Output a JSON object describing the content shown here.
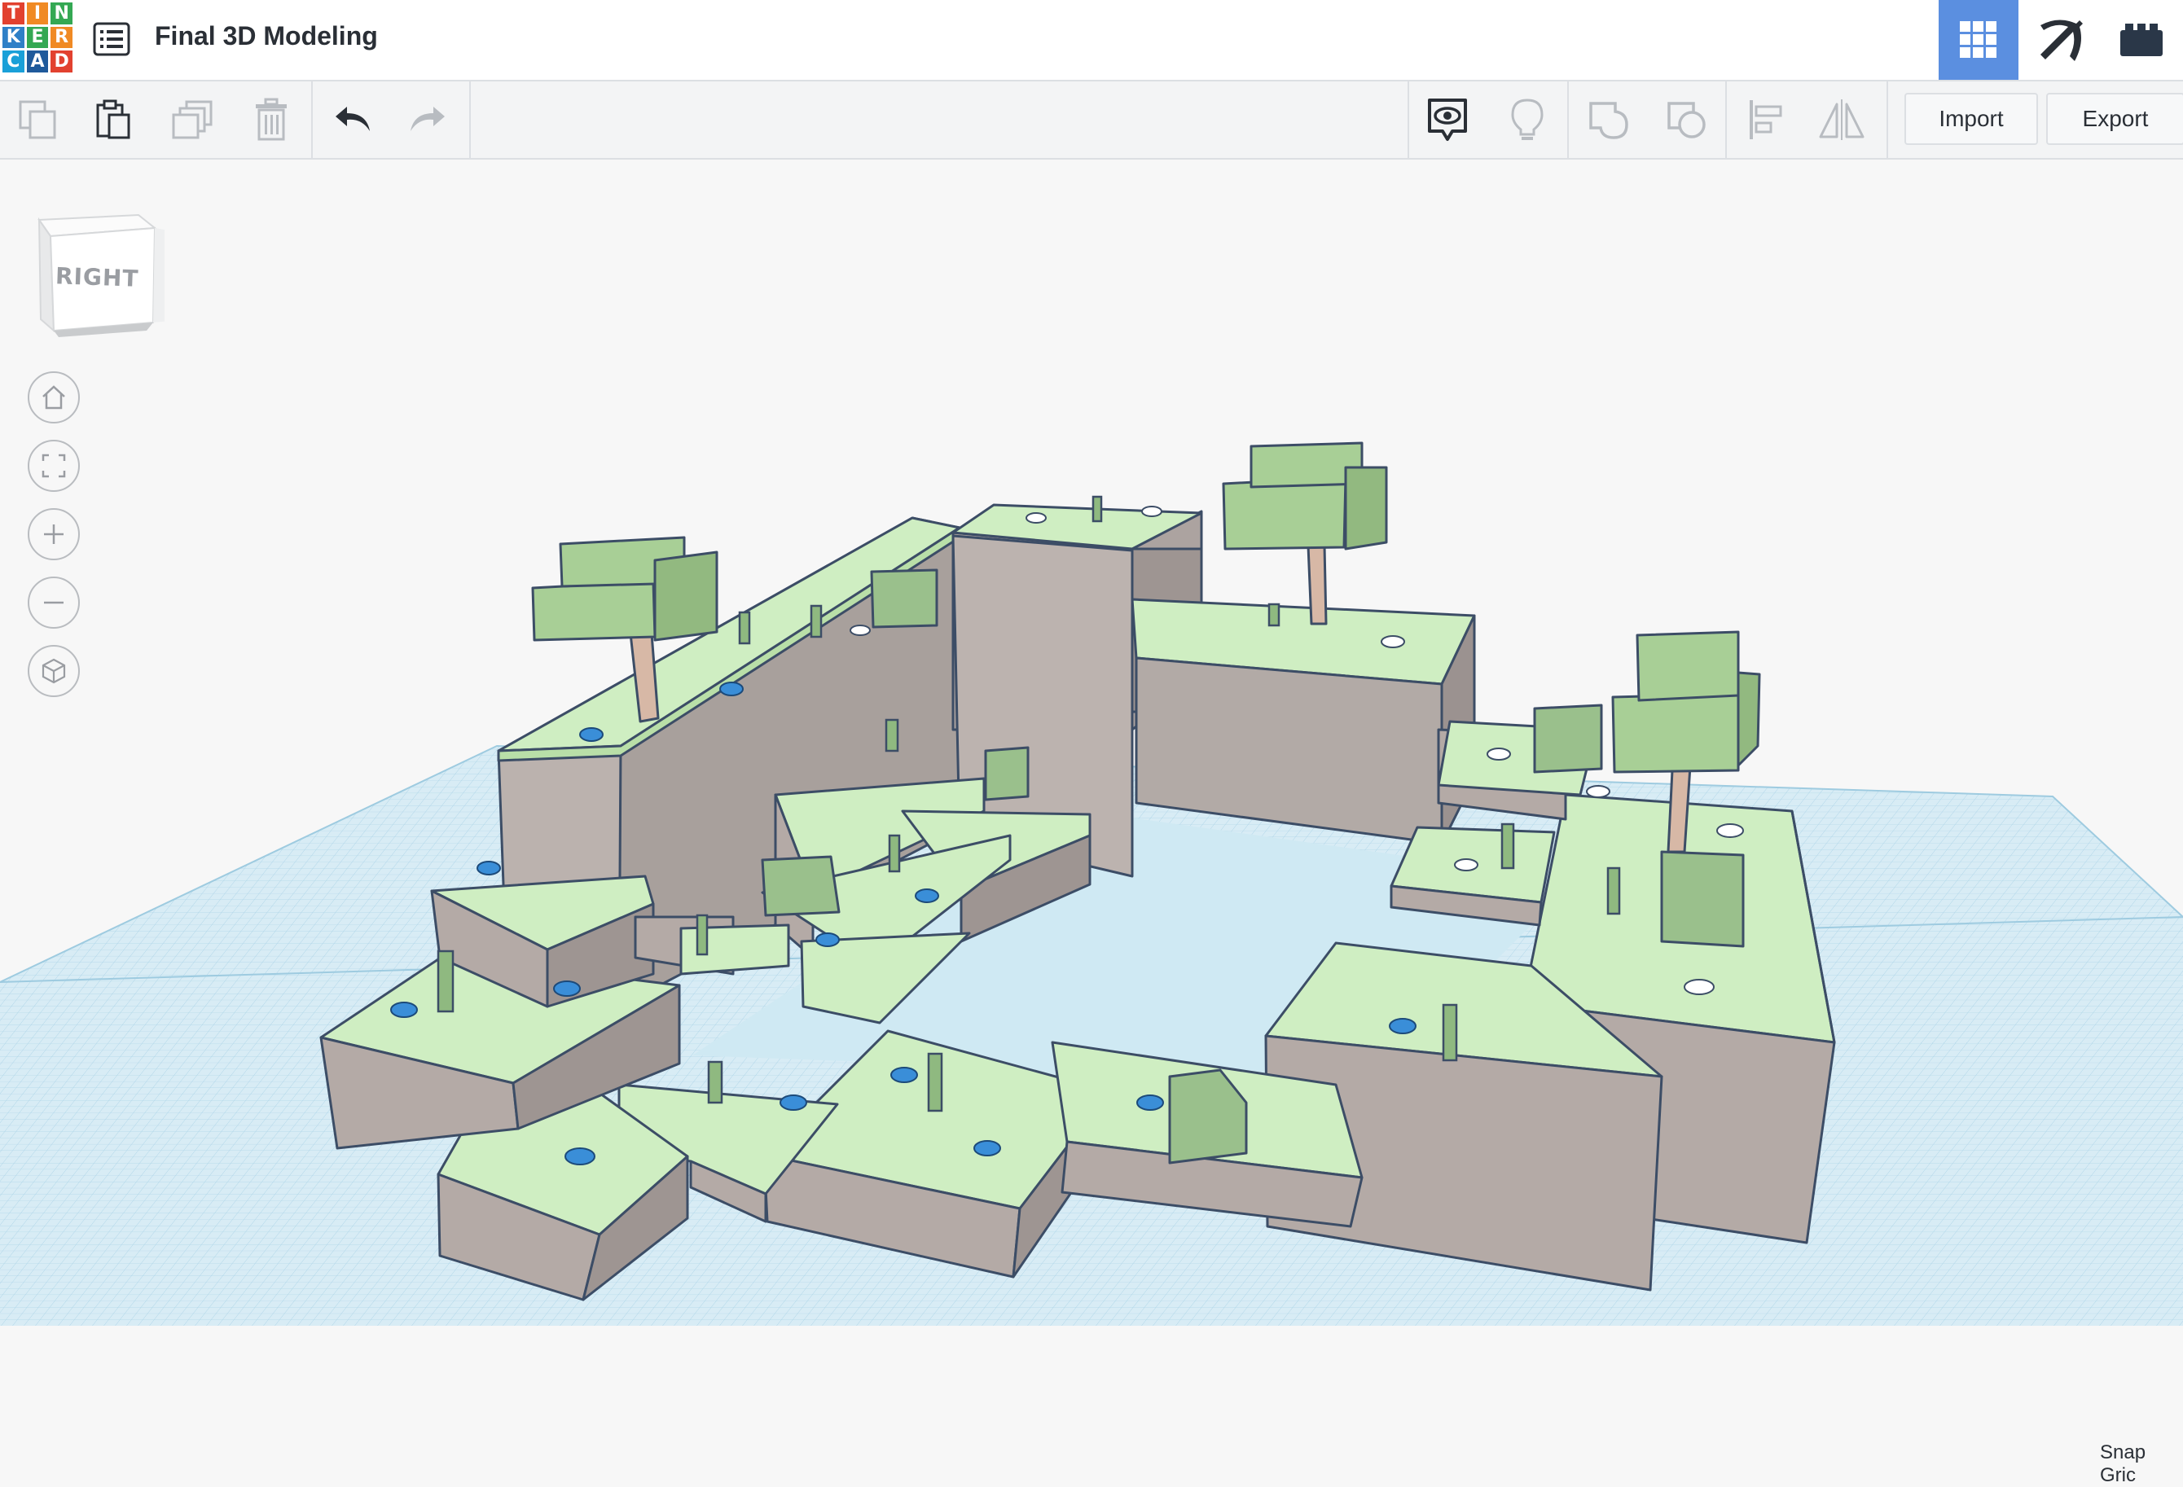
{
  "app": {
    "logo_letters": [
      "T",
      "I",
      "N",
      "K",
      "E",
      "R",
      "C",
      "A",
      "D"
    ],
    "project_title": "Final 3D Modeling"
  },
  "header": {
    "modes": [
      {
        "name": "3d-design",
        "icon": "grid-icon",
        "active": true
      },
      {
        "name": "minecraft",
        "icon": "pickaxe-icon",
        "active": false
      },
      {
        "name": "bricks",
        "icon": "brick-icon",
        "active": false
      }
    ]
  },
  "toolbar": {
    "left_tools": [
      "copy-icon",
      "paste-icon",
      "duplicate-icon",
      "delete-icon",
      "undo-icon",
      "redo-icon"
    ],
    "right_tools": [
      "show-all-icon",
      "light-bulb-icon",
      "group-icon",
      "ungroup-icon",
      "align-icon",
      "mirror-icon"
    ],
    "import_label": "Import",
    "export_label": "Export"
  },
  "viewport": {
    "viewcube_label": "RIGHT",
    "nav_controls": [
      "home-view-icon",
      "fit-view-icon",
      "zoom-in-icon",
      "zoom-out-icon",
      "ortho-view-icon"
    ],
    "snap_grid_label": "Snap Gric"
  },
  "colors": {
    "accent": "#5b8fe0",
    "grass": "#cfeec2",
    "dirt": "#b4aaa6",
    "water": "#cfe9f3",
    "workplane": "#d6ebf4"
  }
}
